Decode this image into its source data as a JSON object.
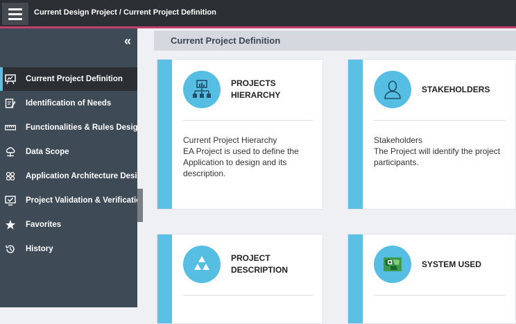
{
  "header": {
    "breadcrumb": "Current Design Project / Current Project Definition",
    "menu_icon": "hamburger-menu-icon"
  },
  "sidebar": {
    "collapse_label": "«",
    "items": [
      {
        "label": "Current Project Definition",
        "icon": "presentation-icon",
        "active": true
      },
      {
        "label": "Identification of Needs",
        "icon": "edit-note-icon"
      },
      {
        "label": "Functionalities & Rules Design",
        "icon": "ruler-icon"
      },
      {
        "label": "Data Scope",
        "icon": "cloud-network-icon"
      },
      {
        "label": "Application Architecture Design",
        "icon": "architecture-icon"
      },
      {
        "label": "Project Validation & Verification",
        "icon": "monitor-check-icon"
      },
      {
        "label": "Favorites",
        "icon": "star-icon"
      },
      {
        "label": "History",
        "icon": "history-icon"
      }
    ]
  },
  "main": {
    "section_title": "Current Project Definition",
    "cards": [
      {
        "title_line1": "PROJECTS",
        "title_line2": "HIERARCHY",
        "icon": "hierarchy-chart-icon",
        "desc_line1": "Current Project Hierarchy",
        "desc_rest": "EA Project is used to define the Application to design and its description."
      },
      {
        "title_line1": "STAKEHOLDERS",
        "title_line2": "",
        "icon": "person-icon",
        "desc_line1": "Stakeholders",
        "desc_rest": "The Project will identify the project participants."
      },
      {
        "title_line1": "PROJECT",
        "title_line2": "DESCRIPTION",
        "icon": "triangle-blocks-icon",
        "desc_line1": "",
        "desc_rest": ""
      },
      {
        "title_line1": "SYSTEM USED",
        "title_line2": "",
        "icon": "system-map-icon",
        "desc_line1": "",
        "desc_rest": ""
      }
    ]
  },
  "colors": {
    "topbar": "#2c2f33",
    "accent": "#c5416b",
    "sidebar": "#3f4a57",
    "card_stripe": "#5bc0e4",
    "icon_circle": "#56bde3"
  }
}
